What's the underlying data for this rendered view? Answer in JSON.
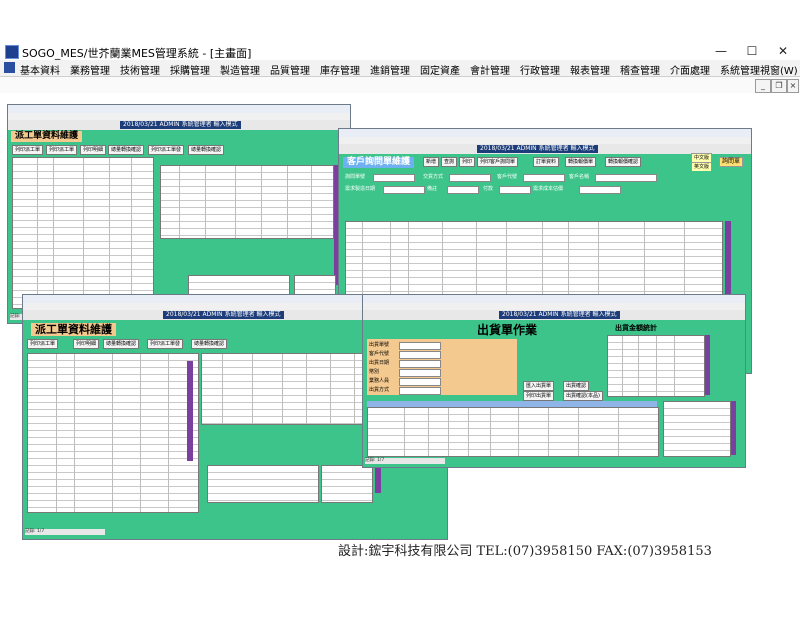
{
  "app": {
    "title": "SOGO_MES/世芥蘭業MES管理系統 - [主畫面]",
    "controls": {
      "minimize": "—",
      "maximize": "☐",
      "close": "✕",
      "sub_minimize": "_",
      "sub_restore": "❐",
      "sub_close": "×"
    }
  },
  "menu": {
    "items": [
      "基本資料",
      "業務管理",
      "技術管理",
      "採購管理",
      "製造管理",
      "品質管理",
      "庫存管理",
      "進銷管理",
      "固定資產",
      "會計管理",
      "行政管理",
      "報表管理",
      "稽查管理",
      "介面處理",
      "系統管理",
      "視窗(W)"
    ]
  },
  "info_bar": {
    "date": "2018/03/21",
    "user": "ADMIN",
    "role": "系統管理者",
    "mode": "輸入模式"
  },
  "windows": {
    "dispatch_back": {
      "form_title": "派工單資料維護",
      "buttons": [
        "列印派工單",
        "列印派工單",
        "列印明細",
        "總量轉換確認",
        "列印派工單發",
        "總量轉換確認"
      ],
      "status": "記錄: 1/7"
    },
    "customer_order": {
      "form_title": "客戶詢問單維護",
      "buttons": [
        "新增",
        "查詢",
        "列印",
        "列印客戶詢問單",
        "訂單資料",
        "轉換報價單",
        "轉換報價確認"
      ],
      "tag_button": "詢問單",
      "radio": [
        "中文版",
        "英文版"
      ],
      "labels": [
        "詢問單號",
        "交貨方式",
        "客戶代號",
        "客戶名稱",
        "需求製造日期",
        "備註",
        "付款",
        "需求成本估價"
      ]
    },
    "dispatch_front": {
      "form_title": "派工單資料維護",
      "buttons": [
        "列印派工單",
        "列印明細",
        "總量轉換確認",
        "列印派工單發",
        "總量轉換確認"
      ],
      "status": "記錄: 1/7"
    },
    "shipping": {
      "form_title": "出貨單作業",
      "side_title": "出貨金額統計",
      "labels": [
        "出貨單號",
        "客戶代號",
        "出貨日期",
        "幣別",
        "業務人員",
        "出貨方式"
      ],
      "buttons": [
        "匯入出貨單",
        "列印出貨單",
        "出貨確認",
        "出貨確認(本品)"
      ],
      "status": "記錄: 1/7"
    }
  },
  "footer": "設計:鋐宇科技有限公司 TEL:(07)3958150 FAX:(07)3958153"
}
